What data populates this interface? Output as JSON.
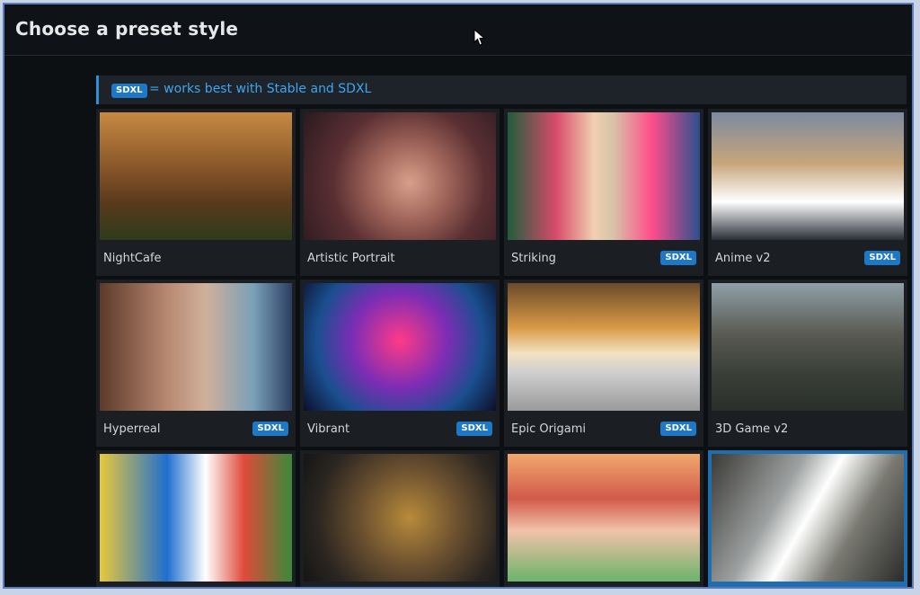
{
  "header": {
    "title": "Choose a preset style"
  },
  "notice": {
    "badge": "SDXL",
    "text": "= works best with Stable and SDXL"
  },
  "presets": [
    {
      "label": "NightCafe",
      "badge": ""
    },
    {
      "label": "Artistic Portrait",
      "badge": ""
    },
    {
      "label": "Striking",
      "badge": "SDXL"
    },
    {
      "label": "Anime v2",
      "badge": "SDXL"
    },
    {
      "label": "Hyperreal",
      "badge": "SDXL"
    },
    {
      "label": "Vibrant",
      "badge": "SDXL"
    },
    {
      "label": "Epic Origami",
      "badge": "SDXL"
    },
    {
      "label": "3D Game v2",
      "badge": ""
    },
    {
      "label": "",
      "badge": ""
    },
    {
      "label": "",
      "badge": ""
    },
    {
      "label": "",
      "badge": ""
    },
    {
      "label": "",
      "badge": ""
    }
  ],
  "colors": {
    "accent": "#1f6fb0",
    "badge": "#1d78c8",
    "background": "#0d1013"
  },
  "icons": {
    "cursor": "mouse-pointer-icon"
  }
}
